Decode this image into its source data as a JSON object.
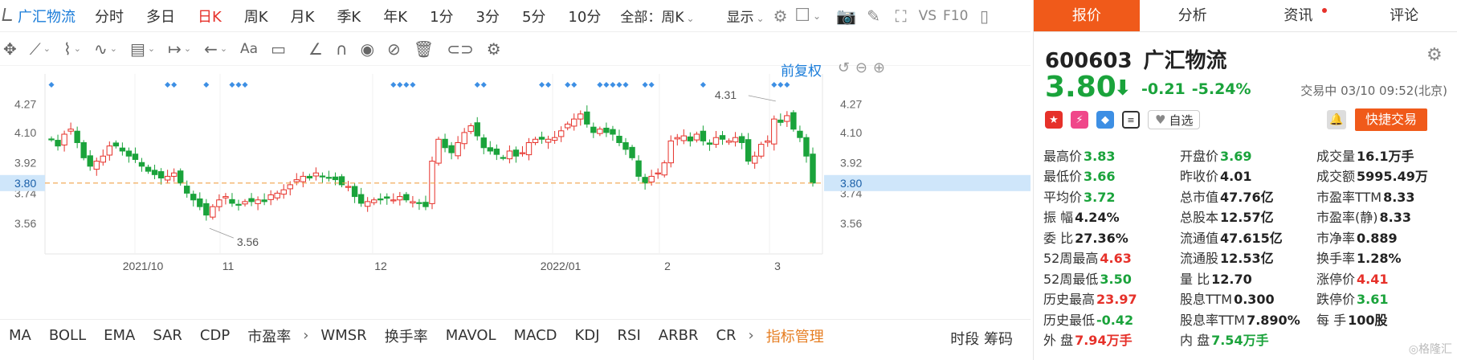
{
  "toolbar": {
    "title": "广汇物流",
    "periods": [
      "分时",
      "多日",
      "日K",
      "周K",
      "月K",
      "季K",
      "年K",
      "1分",
      "3分",
      "5分",
      "10分"
    ],
    "active_period": "日K",
    "selector": "全部：周K",
    "display": "显示",
    "vs": "VS",
    "f10": "F10"
  },
  "chart_toolbar": {
    "font_tool": "Aa"
  },
  "chart": {
    "fuquan": "前复权",
    "price_ticks": [
      "4.27",
      "4.10",
      "3.92",
      "3.74",
      "3.56"
    ],
    "current_price": "3.80",
    "date_labels": [
      "2021/10",
      "11",
      "12",
      "2022/01",
      "2",
      "3"
    ],
    "high_label": "4.31",
    "low_label": "3.56",
    "colors": {
      "up": "#e6312a",
      "down": "#1aa33b",
      "line": "#f0a24a",
      "marker": "#3d8fe4",
      "price_tag": "#cfe6fa"
    }
  },
  "chart_data": {
    "type": "candlestick",
    "ylim": [
      3.47,
      4.4
    ],
    "closes": [
      4.06,
      4.02,
      4.09,
      4.12,
      4.04,
      3.95,
      3.9,
      3.93,
      3.96,
      4.02,
      4.02,
      3.99,
      3.96,
      3.94,
      3.9,
      3.87,
      3.85,
      3.83,
      3.84,
      3.86,
      3.8,
      3.74,
      3.7,
      3.66,
      3.61,
      3.66,
      3.7,
      3.72,
      3.68,
      3.67,
      3.69,
      3.69,
      3.7,
      3.69,
      3.73,
      3.74,
      3.76,
      3.79,
      3.82,
      3.84,
      3.83,
      3.86,
      3.84,
      3.83,
      3.82,
      3.79,
      3.78,
      3.72,
      3.68,
      3.69,
      3.7,
      3.7,
      3.71,
      3.7,
      3.72,
      3.7,
      3.69,
      3.68,
      3.66,
      3.93,
      4.06,
      4.01,
      3.98,
      4.04,
      4.1,
      4.14,
      4.08,
      4.01,
      3.99,
      3.97,
      3.95,
      3.99,
      3.96,
      3.98,
      4.04,
      4.06,
      4.06,
      4.06,
      4.07,
      4.11,
      4.15,
      4.18,
      4.21,
      4.15,
      4.1,
      4.12,
      4.1,
      4.09,
      4.04,
      4.0,
      3.95,
      3.84,
      3.8,
      3.84,
      3.86,
      3.92,
      4.05,
      4.07,
      4.08,
      4.05,
      4.09,
      4.05,
      4.03,
      4.07,
      4.06,
      4.05,
      4.07,
      4.04,
      3.93,
      3.96,
      4.03,
      4.05,
      4.18,
      4.16,
      4.2,
      4.12,
      4.07,
      3.96,
      3.8
    ]
  },
  "panel": {
    "tabs": [
      {
        "label": "报价"
      },
      {
        "label": "分析"
      },
      {
        "label": "资讯"
      },
      {
        "label": "评论"
      }
    ],
    "code": "600603",
    "name": "广汇物流",
    "price": "3.80",
    "change": "-0.21",
    "change_pct": "-5.24%",
    "time": "交易中 03/10 09:52(北京)",
    "favorite": "自选",
    "trade_button": "快捷交易",
    "rows": [
      [
        {
          "k": "最高价",
          "v": "3.83",
          "c": "grn"
        },
        {
          "k": "开盘价",
          "v": "3.69",
          "c": "grn"
        },
        {
          "k": "成交量",
          "v": "16.1万手",
          "c": "dk"
        }
      ],
      [
        {
          "k": "最低价",
          "v": "3.66",
          "c": "grn"
        },
        {
          "k": "昨收价",
          "v": "4.01",
          "c": "dk"
        },
        {
          "k": "成交额",
          "v": "5995.49万",
          "c": "dk"
        }
      ],
      [
        {
          "k": "平均价",
          "v": "3.72",
          "c": "grn"
        },
        {
          "k": "总市值",
          "v": "47.76亿",
          "c": "dk"
        },
        {
          "k": "市盈率TTM",
          "v": "8.33",
          "c": "dk"
        }
      ],
      [
        {
          "k": "振 幅",
          "v": "4.24%",
          "c": "dk"
        },
        {
          "k": "总股本",
          "v": "12.57亿",
          "c": "dk"
        },
        {
          "k": "市盈率(静)",
          "v": "8.33",
          "c": "dk"
        }
      ],
      [
        {
          "k": "委 比",
          "v": "27.36%",
          "c": "dk"
        },
        {
          "k": "流通值",
          "v": "47.615亿",
          "c": "dk"
        },
        {
          "k": "市净率",
          "v": "0.889",
          "c": "dk"
        }
      ],
      [
        {
          "k": "52周最高",
          "v": "4.63",
          "c": "red"
        },
        {
          "k": "流通股",
          "v": "12.53亿",
          "c": "dk"
        },
        {
          "k": "换手率",
          "v": "1.28%",
          "c": "dk"
        }
      ],
      [
        {
          "k": "52周最低",
          "v": "3.50",
          "c": "grn"
        },
        {
          "k": "量 比",
          "v": "12.70",
          "c": "dk"
        },
        {
          "k": "涨停价",
          "v": "4.41",
          "c": "red"
        }
      ],
      [
        {
          "k": "历史最高",
          "v": "23.97",
          "c": "red"
        },
        {
          "k": "股息TTM",
          "v": "0.300",
          "c": "dk"
        },
        {
          "k": "跌停价",
          "v": "3.61",
          "c": "grn"
        }
      ],
      [
        {
          "k": "历史最低",
          "v": "-0.42",
          "c": "grn"
        },
        {
          "k": "股息率TTM",
          "v": "7.890%",
          "c": "dk"
        },
        {
          "k": "每 手",
          "v": "100股",
          "c": "dk"
        }
      ],
      [
        {
          "k": "外 盘",
          "v": "7.94万手",
          "c": "red"
        },
        {
          "k": "内 盘",
          "v": "7.54万手",
          "c": "grn"
        },
        {
          "k": "",
          "v": "",
          "c": "dk"
        }
      ]
    ],
    "watermark": "格隆汇"
  },
  "indicators": {
    "items": [
      "MA",
      "BOLL",
      "EMA",
      "SAR",
      "CDP",
      "市盈率",
      "WMSR",
      "换手率",
      "MAVOL",
      "MACD",
      "KDJ",
      "RSI",
      "ARBR",
      "CR"
    ],
    "manager": "指标管理",
    "right": "时段 筹码"
  }
}
